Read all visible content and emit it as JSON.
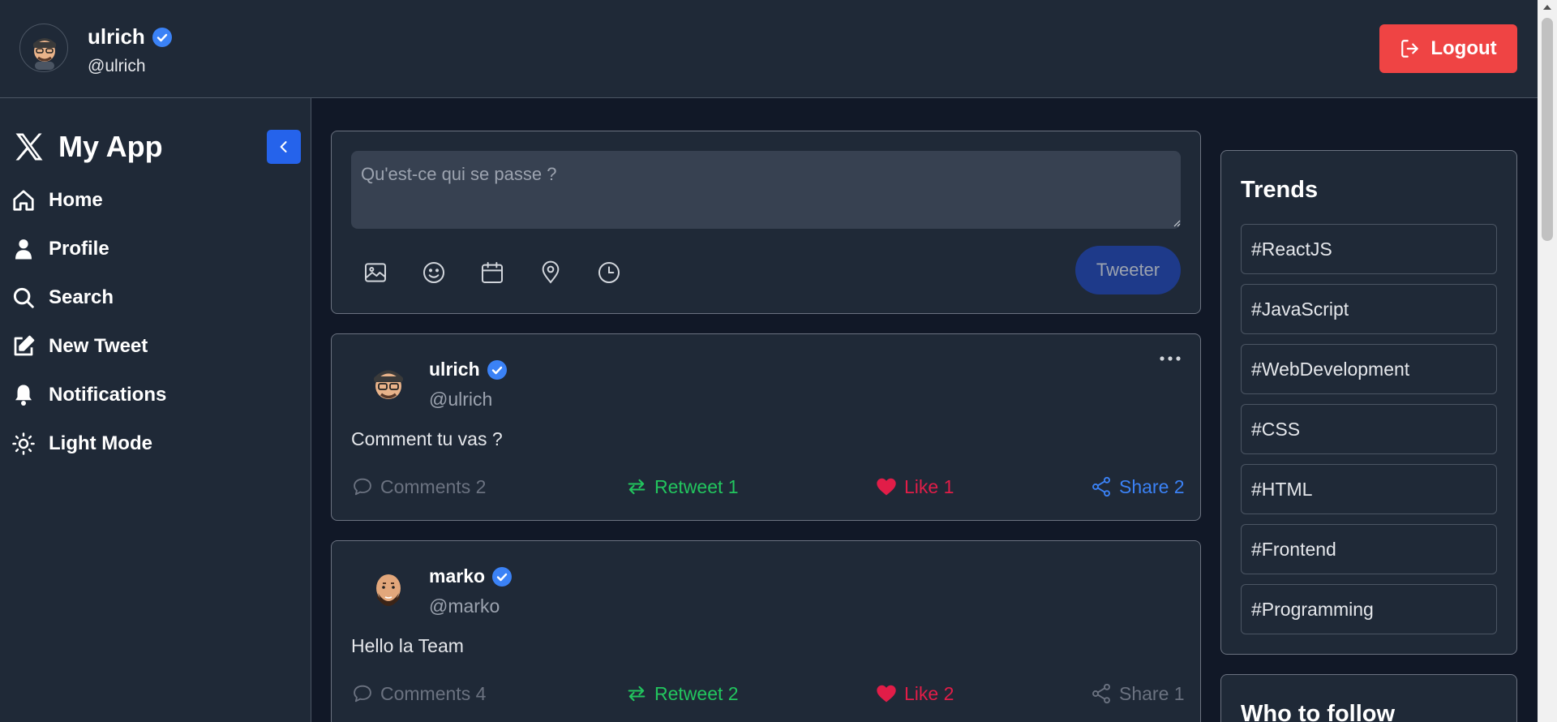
{
  "header": {
    "user_name": "ulrich",
    "user_handle": "@ulrich",
    "logout_label": "Logout"
  },
  "sidebar": {
    "brand": "My App",
    "items": [
      {
        "label": "Home",
        "icon": "home-icon"
      },
      {
        "label": "Profile",
        "icon": "user-icon"
      },
      {
        "label": "Search",
        "icon": "search-icon"
      },
      {
        "label": "New Tweet",
        "icon": "edit-icon"
      },
      {
        "label": "Notifications",
        "icon": "bell-icon"
      },
      {
        "label": "Light Mode",
        "icon": "sun-icon"
      }
    ]
  },
  "composer": {
    "placeholder": "Qu'est-ce qui se passe ?",
    "tweet_label": "Tweeter",
    "tools": [
      "image-icon",
      "emoji-icon",
      "calendar-icon",
      "location-icon",
      "clock-icon"
    ]
  },
  "tweets": [
    {
      "name": "ulrich",
      "handle": "@ulrich",
      "text": "Comment tu vas ?",
      "comments": "Comments 2",
      "retweet": "Retweet 1",
      "like": "Like 1",
      "share": "Share 2",
      "share_active": true
    },
    {
      "name": "marko",
      "handle": "@marko",
      "text": "Hello la Team",
      "comments": "Comments 4",
      "retweet": "Retweet 2",
      "like": "Like 2",
      "share": "Share 1",
      "share_active": false
    }
  ],
  "trends": {
    "title": "Trends",
    "items": [
      "#ReactJS",
      "#JavaScript",
      "#WebDevelopment",
      "#CSS",
      "#HTML",
      "#Frontend",
      "#Programming"
    ]
  },
  "who_to_follow": {
    "title": "Who to follow"
  },
  "colors": {
    "accent": "#2563eb",
    "logout": "#ef4444",
    "verified": "#3b82f6",
    "retweet": "#22c55e",
    "like": "#e11d48"
  }
}
